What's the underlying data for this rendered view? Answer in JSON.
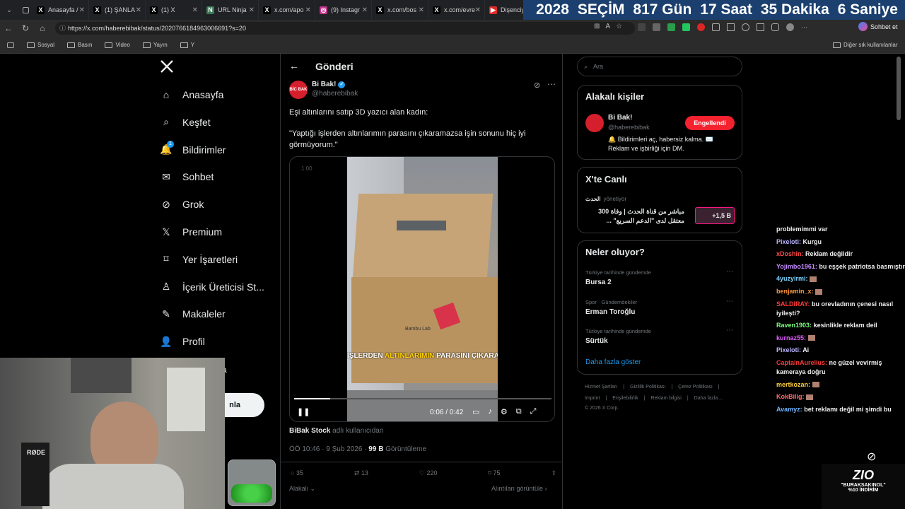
{
  "browser": {
    "tabs": [
      {
        "label": "Anasayfa /",
        "fav": "X",
        "color": "#000000"
      },
      {
        "label": "(1) ŞANLA",
        "fav": "X",
        "color": "#000000"
      },
      {
        "label": "(1) X",
        "fav": "X",
        "color": "#000000"
      },
      {
        "label": "URL Ninja",
        "fav": "N",
        "color": "#3b7a57"
      },
      {
        "label": "x.com/apo",
        "fav": "X",
        "color": "#000000"
      },
      {
        "label": "(9) Instagr",
        "fav": "◎",
        "color": "#c1358c"
      },
      {
        "label": "x.com/bos",
        "fav": "X",
        "color": "#000000"
      },
      {
        "label": "x.com/evre",
        "fav": "X",
        "color": "#000000"
      },
      {
        "label": "Dişenciyi v",
        "fav": "▶",
        "color": "#e02a2a"
      }
    ],
    "url": "https://x.com/haberebibak/status/2020766184963006691?s=20",
    "chat_button": "Sohbet et",
    "bookmarks": [
      "Sosyal",
      "Basın",
      "Video",
      "Yayın",
      "Y"
    ],
    "other_bookmarks": "Diğer sık kullanılanlar"
  },
  "countdown": {
    "year": "2028",
    "label": "SEÇİM",
    "days": "817 Gün",
    "hours": "17 Saat",
    "minutes": "35 Dakika",
    "seconds": "6 Saniye"
  },
  "nav": {
    "items": [
      {
        "label": "Anasayfa",
        "icon": "home-icon"
      },
      {
        "label": "Keşfet",
        "icon": "search-icon"
      },
      {
        "label": "Bildirimler",
        "icon": "bell-icon",
        "badge": "1"
      },
      {
        "label": "Sohbet",
        "icon": "mail-icon"
      },
      {
        "label": "Grok",
        "icon": "grok-icon"
      },
      {
        "label": "Premium",
        "icon": "x-logo-icon"
      },
      {
        "label": "Yer İşaretleri",
        "icon": "bookmark-icon"
      },
      {
        "label": "İçerik Üreticisi St...",
        "icon": "creator-icon"
      },
      {
        "label": "Makaleler",
        "icon": "article-icon"
      },
      {
        "label": "Profil",
        "icon": "profile-icon"
      }
    ],
    "post_button_fragment": "nla",
    "more_fragment": "a"
  },
  "post": {
    "header": "Gönderi",
    "author_name": "Bi Bak!",
    "author_handle": "@haberebibak",
    "avatar_text": "BİC BAK",
    "text_line1": "Eşi altınlarını satıp 3D yazıcı alan kadın:",
    "text_line2": "\"Yaptığı işlerden altınlarımın parasını çıkaramazsa işin sonunu hiç iyi görmüyorum.\"",
    "video": {
      "speed": "1.00",
      "box_brand": "Bambu Lab",
      "subtitle_pre": "İŞLERDEN ",
      "subtitle_mid": "ALTINLARIMIN",
      "subtitle_post": " PARASINI ÇIKARAM",
      "time": "0:06 / 0:42",
      "progress": 0.14
    },
    "tagged_user": "BiBak Stock",
    "tagged_suffix": "adlı kullanıcıdan",
    "timestamp": "ÖÖ 10:46 · 9 Şub 2026 ·",
    "views_count": "99 B",
    "views_label": "Görüntüleme",
    "replies": "35",
    "reposts": "13",
    "likes": "220",
    "bookmarks": "75",
    "related_label": "Alakalı",
    "quotes_label": "Alıntıları görüntüle"
  },
  "right": {
    "search_placeholder": "Ara",
    "related_title": "Alakalı kişiler",
    "related_name": "Bi Bak!",
    "related_handle": "@haberebibak",
    "related_button": "Engellendi",
    "related_bio": "🔔 Bildirimleri aç, habersiz kalma. ✉️ Reklam ve işbirliği için DM.",
    "live_title": "X'te Canlı",
    "live_channel": "الحدث",
    "live_role": "yönetiyor",
    "live_text": "مباشر من قناة الحدث | وفاة 300 معتقل لدى \"الدعم السريع\" ...",
    "live_count": "+1,5 B",
    "trends_title": "Neler oluyor?",
    "trends": [
      {
        "context": "Türkiye tarihinde gündemde",
        "name": "Bursa 2"
      },
      {
        "context": "Spor · Gündemdekiler",
        "name": "Erman Toroğlu"
      },
      {
        "context": "Türkiye tarihinde gündemde",
        "name": "Sürtük"
      }
    ],
    "show_more": "Daha fazla göster",
    "footer_line1": [
      "Hizmet Şartları",
      "Gizlilik Politikası",
      "Çerez Politikası"
    ],
    "footer_line2": [
      "Imprint",
      "Erişilebilirlik",
      "Reklam bilgisi",
      "Daha fazla ..."
    ],
    "copyright": "© 2026 X Corp."
  },
  "chat": {
    "messages": [
      {
        "user": "",
        "text": "problemimmi var",
        "color": "#ffffff"
      },
      {
        "user": "Pixeloti:",
        "text": "Kurgu",
        "color": "#b9b4ff"
      },
      {
        "user": "xDoshin:",
        "text": "Reklam değildir",
        "color": "#ff4b4b"
      },
      {
        "user": "Yojimbo1961:",
        "text": "bu eşşek patriotsa basmıştır",
        "color": "#c58cff"
      },
      {
        "user": "4yuzyirmi:",
        "text": "",
        "color": "#7fd4ff"
      },
      {
        "user": "benjamin_x:",
        "text": "",
        "color": "#ff9a3c"
      },
      {
        "user": "SALDIRAY:",
        "text": "bu orevladının çenesi nasıl iyileşti?",
        "color": "#ff3b3b"
      },
      {
        "user": "Raven1903:",
        "text": "kesinlikle reklam deil",
        "color": "#7dff7d"
      },
      {
        "user": "kurnaz55:",
        "text": "",
        "color": "#e35cff"
      },
      {
        "user": "Pixeloti:",
        "text": "Ai",
        "color": "#b9b4ff"
      },
      {
        "user": "CaptainAurelius:",
        "text": "ne güzel vevirmiş kameraya doğru",
        "color": "#ff3b3b"
      },
      {
        "user": "mertkozan:",
        "text": "",
        "color": "#ffd23c"
      },
      {
        "user": "KokBilig:",
        "text": "",
        "color": "#ff6a6a"
      },
      {
        "user": "Avamyz:",
        "text": "bet reklamı değil mi şimdi bu",
        "color": "#6fb6ff"
      }
    ]
  },
  "overlay": {
    "brand": "ZIO",
    "promo_code": "\"BURAKSAKINOL\"",
    "promo_discount": "%10 İNDİRİM",
    "mic_label": "RØDE"
  }
}
